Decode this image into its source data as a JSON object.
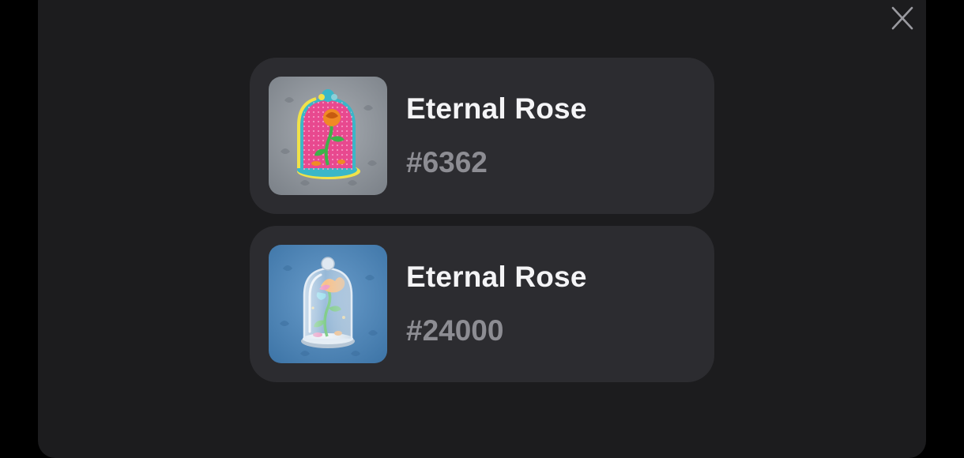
{
  "close_icon": "close-icon",
  "items": [
    {
      "title": "Eternal Rose",
      "number": "#6362",
      "background": "#8a9097",
      "icon": "rose-in-glass-dome-icon"
    },
    {
      "title": "Eternal Rose",
      "number": "#24000",
      "background": "#4f86b8",
      "icon": "rose-in-glass-dome-icon"
    }
  ]
}
